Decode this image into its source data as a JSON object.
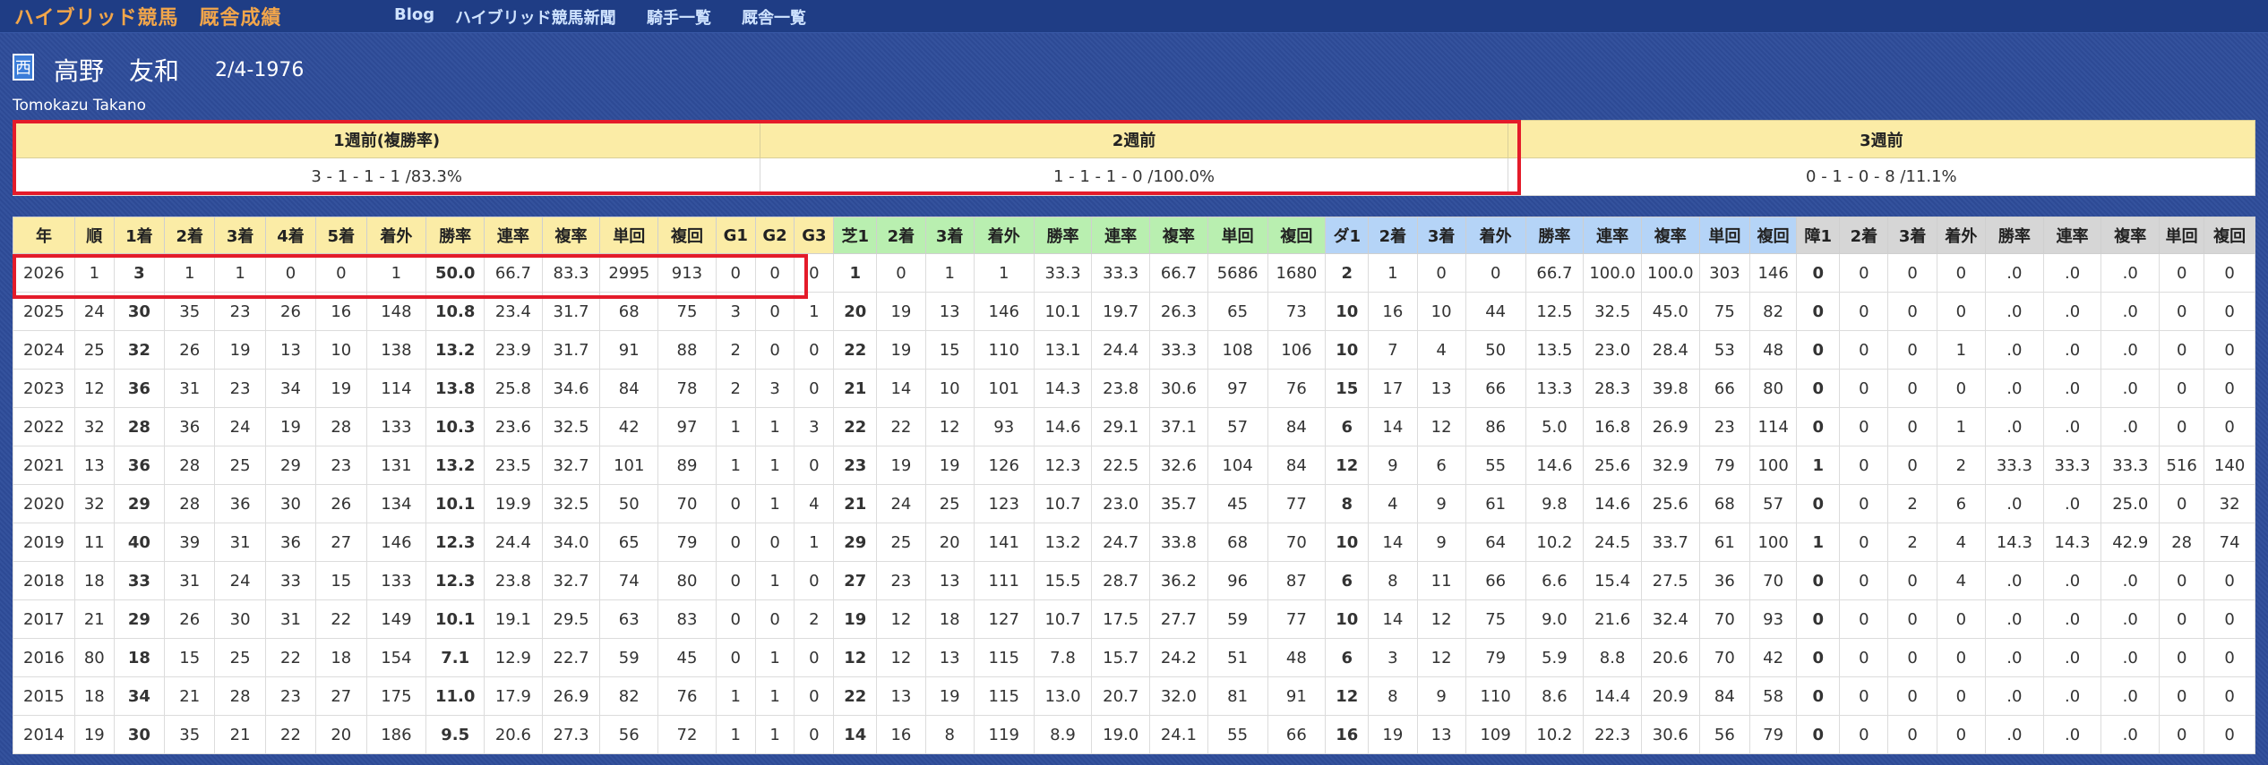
{
  "nav": {
    "site_title": "ハイブリッド競馬　厩舎成績",
    "links": [
      "Blog",
      "ハイブリッド競馬新聞",
      "騎手一覧",
      "厩舎一覧"
    ]
  },
  "jockey": {
    "region": "西",
    "name": "高野　友和",
    "birthdate": "2/4-1976",
    "english_name": "Tomokazu Takano"
  },
  "weekly": {
    "headers": [
      "1週前(複勝率)",
      "2週前",
      "3週前"
    ],
    "values": [
      "3 - 1 - 1 - 1 /83.3%",
      "1 - 1 - 1 - 0 /100.0%",
      "0 - 1 - 0 - 8 /11.1%"
    ]
  },
  "table": {
    "headers": [
      "年",
      "順",
      "1着",
      "2着",
      "3着",
      "4着",
      "5着",
      "着外",
      "勝率",
      "連率",
      "複率",
      "単回",
      "複回",
      "G1",
      "G2",
      "G3",
      "芝1",
      "2着",
      "3着",
      "着外",
      "勝率",
      "連率",
      "複率",
      "単回",
      "複回",
      "ダ1",
      "2着",
      "3着",
      "着外",
      "勝率",
      "連率",
      "複率",
      "単回",
      "複回",
      "障1",
      "2着",
      "3着",
      "着外",
      "勝率",
      "連率",
      "複率",
      "単回",
      "複回"
    ],
    "rows": [
      [
        "2026",
        "1",
        "3",
        "1",
        "1",
        "0",
        "0",
        "1",
        "50.0",
        "66.7",
        "83.3",
        "2995",
        "913",
        "0",
        "0",
        "0",
        "1",
        "0",
        "1",
        "1",
        "33.3",
        "33.3",
        "66.7",
        "5686",
        "1680",
        "2",
        "1",
        "0",
        "0",
        "66.7",
        "100.0",
        "100.0",
        "303",
        "146",
        "0",
        "0",
        "0",
        "0",
        ".0",
        ".0",
        ".0",
        "0",
        "0"
      ],
      [
        "2025",
        "24",
        "30",
        "35",
        "23",
        "26",
        "16",
        "148",
        "10.8",
        "23.4",
        "31.7",
        "68",
        "75",
        "3",
        "0",
        "1",
        "20",
        "19",
        "13",
        "146",
        "10.1",
        "19.7",
        "26.3",
        "65",
        "73",
        "10",
        "16",
        "10",
        "44",
        "12.5",
        "32.5",
        "45.0",
        "75",
        "82",
        "0",
        "0",
        "0",
        "0",
        ".0",
        ".0",
        ".0",
        "0",
        "0"
      ],
      [
        "2024",
        "25",
        "32",
        "26",
        "19",
        "13",
        "10",
        "138",
        "13.2",
        "23.9",
        "31.7",
        "91",
        "88",
        "2",
        "0",
        "0",
        "22",
        "19",
        "15",
        "110",
        "13.1",
        "24.4",
        "33.3",
        "108",
        "106",
        "10",
        "7",
        "4",
        "50",
        "13.5",
        "23.0",
        "28.4",
        "53",
        "48",
        "0",
        "0",
        "0",
        "1",
        ".0",
        ".0",
        ".0",
        "0",
        "0"
      ],
      [
        "2023",
        "12",
        "36",
        "31",
        "23",
        "34",
        "19",
        "114",
        "13.8",
        "25.8",
        "34.6",
        "84",
        "78",
        "2",
        "3",
        "0",
        "21",
        "14",
        "10",
        "101",
        "14.3",
        "23.8",
        "30.6",
        "97",
        "76",
        "15",
        "17",
        "13",
        "66",
        "13.3",
        "28.3",
        "39.8",
        "66",
        "80",
        "0",
        "0",
        "0",
        "0",
        ".0",
        ".0",
        ".0",
        "0",
        "0"
      ],
      [
        "2022",
        "32",
        "28",
        "36",
        "24",
        "19",
        "28",
        "133",
        "10.3",
        "23.6",
        "32.5",
        "42",
        "97",
        "1",
        "1",
        "3",
        "22",
        "22",
        "12",
        "93",
        "14.6",
        "29.1",
        "37.1",
        "57",
        "84",
        "6",
        "14",
        "12",
        "86",
        "5.0",
        "16.8",
        "26.9",
        "23",
        "114",
        "0",
        "0",
        "0",
        "1",
        ".0",
        ".0",
        ".0",
        "0",
        "0"
      ],
      [
        "2021",
        "13",
        "36",
        "28",
        "25",
        "29",
        "23",
        "131",
        "13.2",
        "23.5",
        "32.7",
        "101",
        "89",
        "1",
        "1",
        "0",
        "23",
        "19",
        "19",
        "126",
        "12.3",
        "22.5",
        "32.6",
        "104",
        "84",
        "12",
        "9",
        "6",
        "55",
        "14.6",
        "25.6",
        "32.9",
        "79",
        "100",
        "1",
        "0",
        "0",
        "2",
        "33.3",
        "33.3",
        "33.3",
        "516",
        "140"
      ],
      [
        "2020",
        "32",
        "29",
        "28",
        "36",
        "30",
        "26",
        "134",
        "10.1",
        "19.9",
        "32.5",
        "50",
        "70",
        "0",
        "1",
        "4",
        "21",
        "24",
        "25",
        "123",
        "10.7",
        "23.0",
        "35.7",
        "45",
        "77",
        "8",
        "4",
        "9",
        "61",
        "9.8",
        "14.6",
        "25.6",
        "68",
        "57",
        "0",
        "0",
        "2",
        "6",
        ".0",
        ".0",
        "25.0",
        "0",
        "32"
      ],
      [
        "2019",
        "11",
        "40",
        "39",
        "31",
        "36",
        "27",
        "146",
        "12.3",
        "24.4",
        "34.0",
        "65",
        "79",
        "0",
        "0",
        "1",
        "29",
        "25",
        "20",
        "141",
        "13.2",
        "24.7",
        "33.8",
        "68",
        "70",
        "10",
        "14",
        "9",
        "64",
        "10.2",
        "24.5",
        "33.7",
        "61",
        "100",
        "1",
        "0",
        "2",
        "4",
        "14.3",
        "14.3",
        "42.9",
        "28",
        "74"
      ],
      [
        "2018",
        "18",
        "33",
        "31",
        "24",
        "33",
        "15",
        "133",
        "12.3",
        "23.8",
        "32.7",
        "74",
        "80",
        "0",
        "1",
        "0",
        "27",
        "23",
        "13",
        "111",
        "15.5",
        "28.7",
        "36.2",
        "96",
        "87",
        "6",
        "8",
        "11",
        "66",
        "6.6",
        "15.4",
        "27.5",
        "36",
        "70",
        "0",
        "0",
        "0",
        "4",
        ".0",
        ".0",
        ".0",
        "0",
        "0"
      ],
      [
        "2017",
        "21",
        "29",
        "26",
        "30",
        "31",
        "22",
        "149",
        "10.1",
        "19.1",
        "29.5",
        "63",
        "83",
        "0",
        "0",
        "2",
        "19",
        "12",
        "18",
        "127",
        "10.7",
        "17.5",
        "27.7",
        "59",
        "77",
        "10",
        "14",
        "12",
        "75",
        "9.0",
        "21.6",
        "32.4",
        "70",
        "93",
        "0",
        "0",
        "0",
        "0",
        ".0",
        ".0",
        ".0",
        "0",
        "0"
      ],
      [
        "2016",
        "80",
        "18",
        "15",
        "25",
        "22",
        "18",
        "154",
        "7.1",
        "12.9",
        "22.7",
        "59",
        "45",
        "0",
        "1",
        "0",
        "12",
        "12",
        "13",
        "115",
        "7.8",
        "15.7",
        "24.2",
        "51",
        "48",
        "6",
        "3",
        "12",
        "79",
        "5.9",
        "8.8",
        "20.6",
        "70",
        "42",
        "0",
        "0",
        "0",
        "0",
        ".0",
        ".0",
        ".0",
        "0",
        "0"
      ],
      [
        "2015",
        "18",
        "34",
        "21",
        "28",
        "23",
        "27",
        "175",
        "11.0",
        "17.9",
        "26.9",
        "82",
        "76",
        "1",
        "1",
        "0",
        "22",
        "13",
        "19",
        "115",
        "13.0",
        "20.7",
        "32.0",
        "81",
        "91",
        "12",
        "8",
        "9",
        "110",
        "8.6",
        "14.4",
        "20.9",
        "84",
        "58",
        "0",
        "0",
        "0",
        "0",
        ".0",
        ".0",
        ".0",
        "0",
        "0"
      ],
      [
        "2014",
        "19",
        "30",
        "35",
        "21",
        "22",
        "20",
        "186",
        "9.5",
        "20.6",
        "27.3",
        "56",
        "72",
        "1",
        "1",
        "0",
        "14",
        "16",
        "8",
        "119",
        "8.9",
        "19.0",
        "24.1",
        "55",
        "66",
        "16",
        "19",
        "13",
        "109",
        "10.2",
        "22.3",
        "30.6",
        "56",
        "79",
        "0",
        "0",
        "0",
        "0",
        ".0",
        ".0",
        ".0",
        "0",
        "0"
      ]
    ]
  }
}
